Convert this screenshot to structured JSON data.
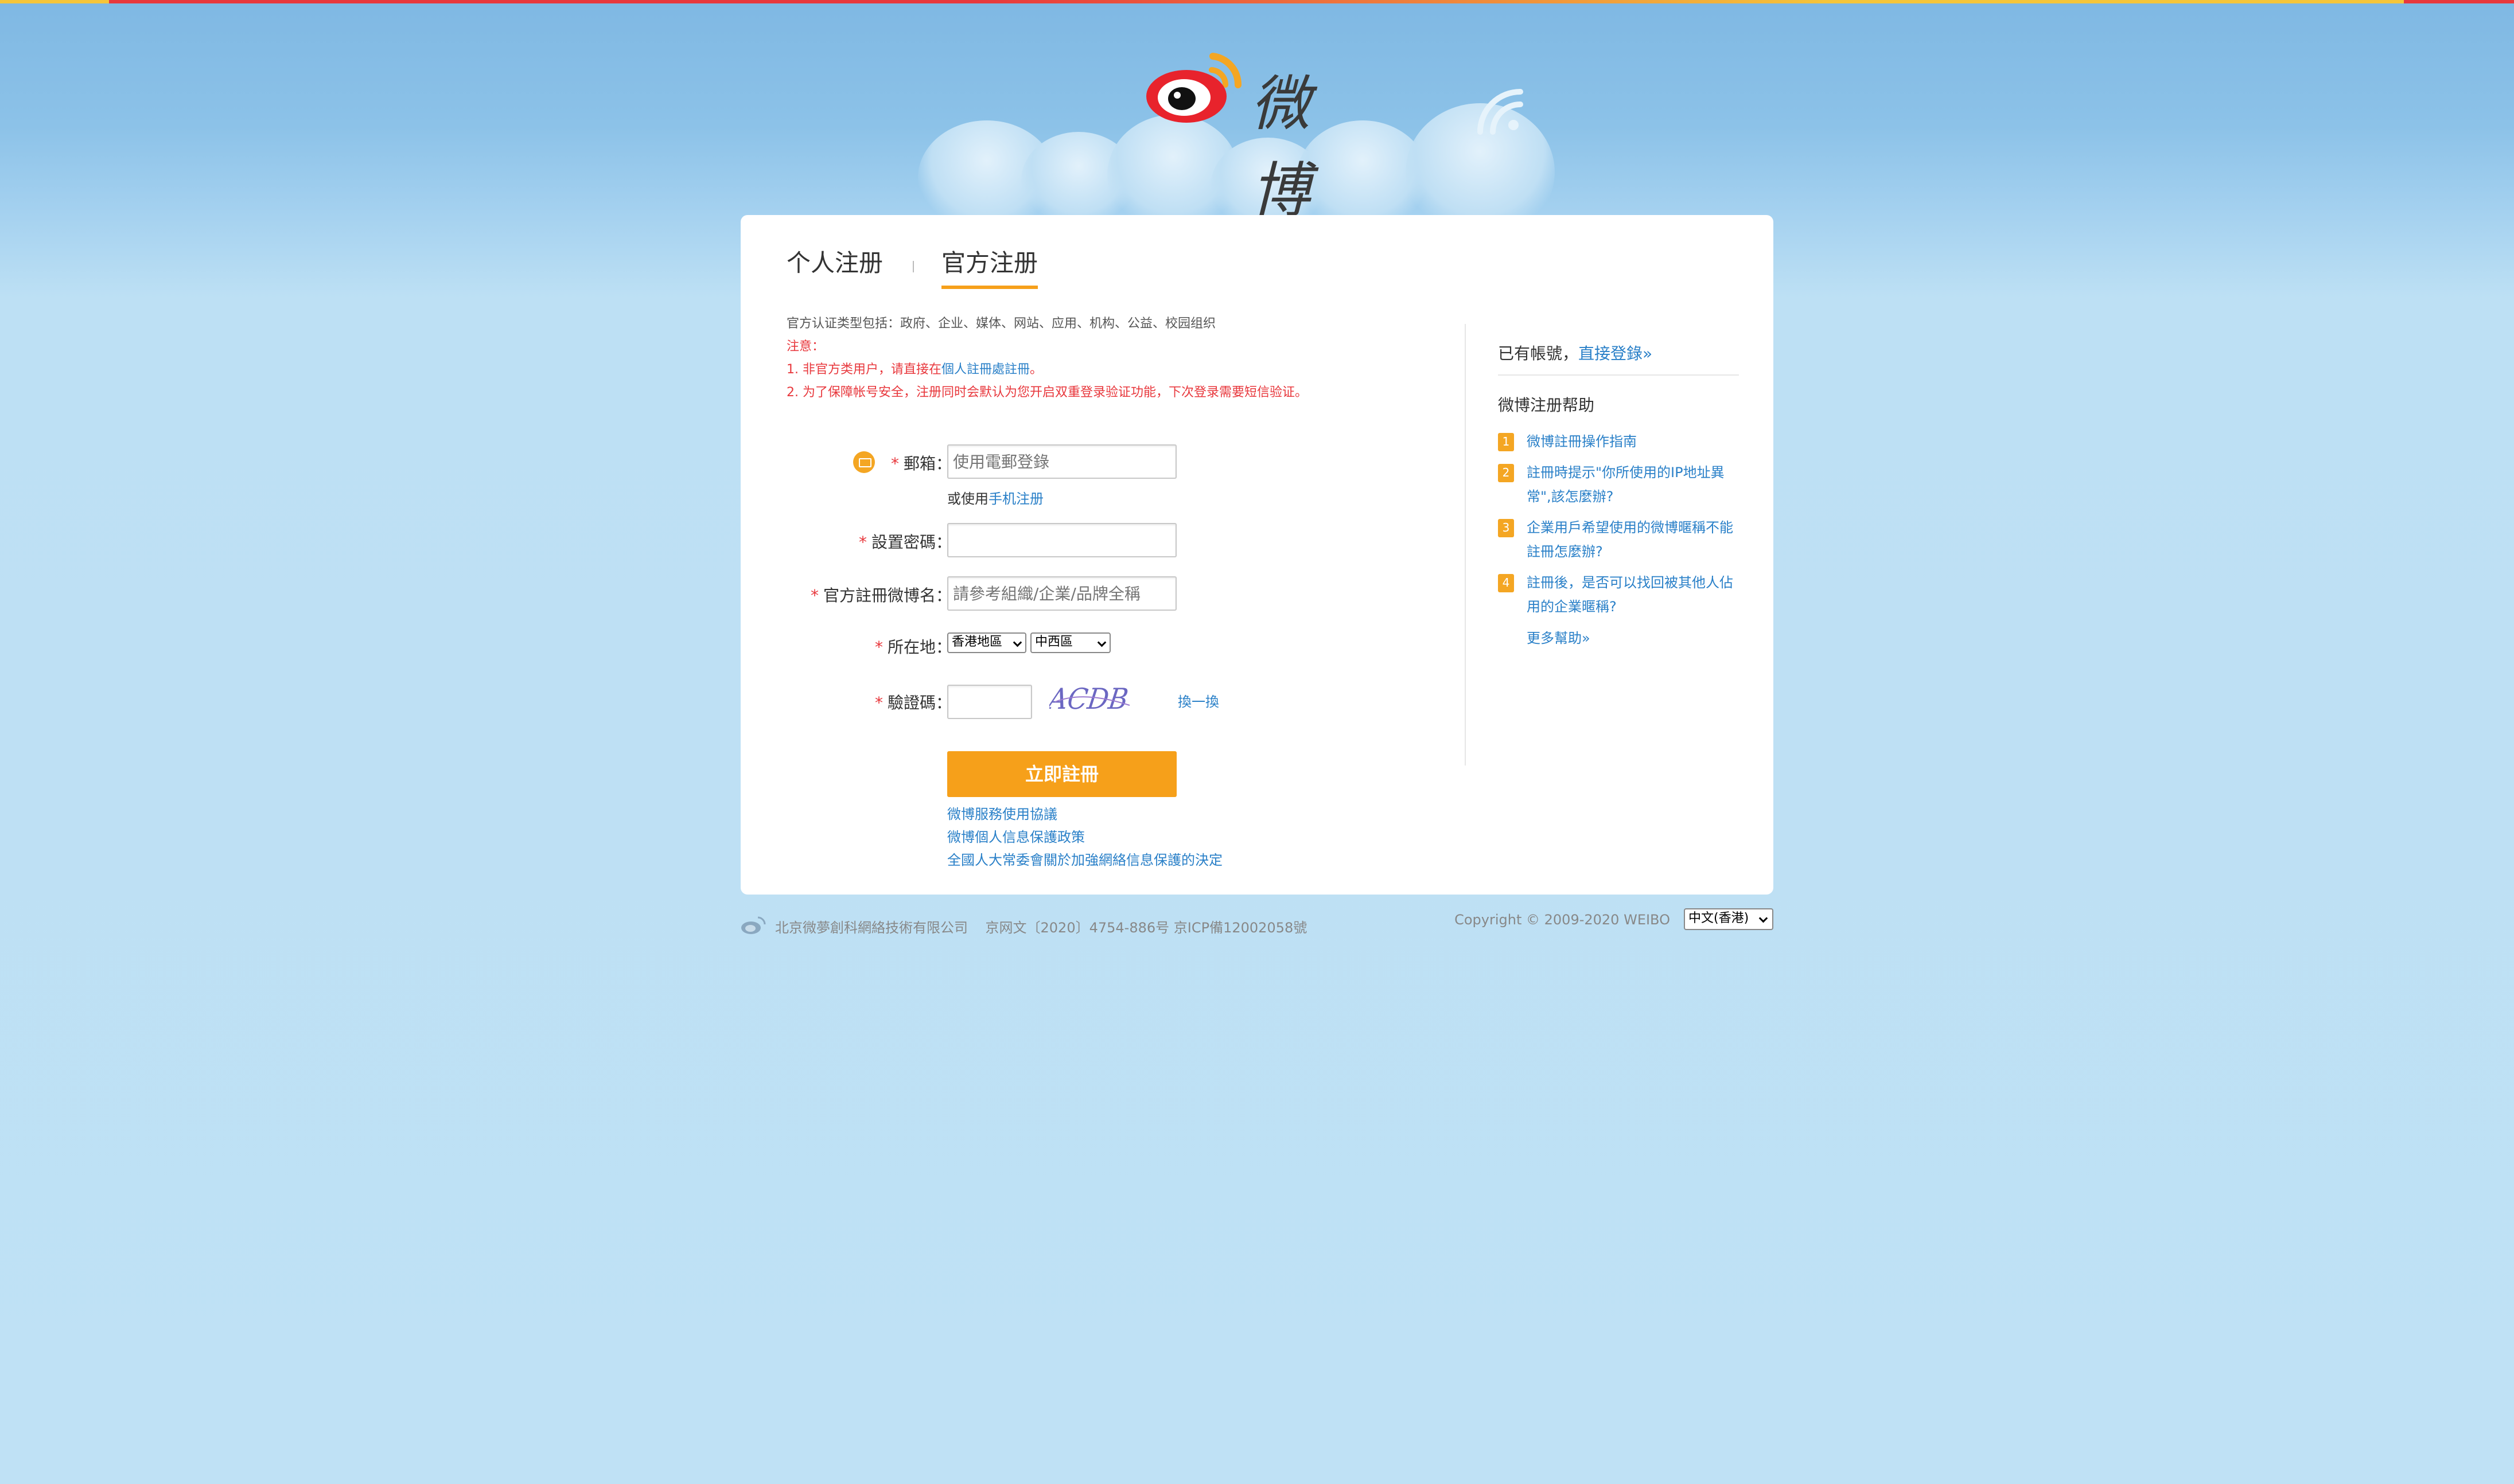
{
  "brand": {
    "logo_text": "微博"
  },
  "tabs": {
    "personal": "个人注册",
    "official": "官方注册"
  },
  "notes": {
    "types": "官方认证类型包括：政府、企业、媒体、网站、应用、机构、公益、校园组织",
    "notice_title": "注意：",
    "note1_prefix": "1. 非官方类用户，请直接在",
    "note1_link": "個人註冊處註冊",
    "note1_suffix": "。",
    "note2": "2. 为了保障帐号安全，注册同时会默认为您开启双重登录验证功能，下次登录需要短信验证。"
  },
  "form": {
    "required_mark": "*",
    "email_label": "郵箱：",
    "email_placeholder": "使用電郵登錄",
    "alt_prefix": "或使用",
    "alt_link": "手机注册",
    "password_label": "設置密碼：",
    "name_label": "官方註冊微博名：",
    "name_placeholder": "請參考組織/企業/品牌全稱",
    "location_label": "所在地：",
    "region_value": "香港地區",
    "district_value": "中西區",
    "captcha_label": "驗證碼：",
    "captcha_text": "ACDB",
    "refresh_label": "換一換",
    "submit_label": "立即註冊"
  },
  "policies": [
    "微博服務使用協議",
    "微博個人信息保護政策",
    "全國人大常委會關於加強網絡信息保護的決定"
  ],
  "sidebar": {
    "has_account": "已有帳號，",
    "login_link": "直接登錄»",
    "help_title": "微博注册帮助",
    "help_items": [
      {
        "num": "1",
        "text": "微博註冊操作指南"
      },
      {
        "num": "2",
        "text": "註冊時提示\"你所使用的IP地址異常\",該怎麼辦?"
      },
      {
        "num": "3",
        "text": "企業用戶希望使用的微博暱稱不能註冊怎麼辦?"
      },
      {
        "num": "4",
        "text": "註冊後，是否可以找回被其他人佔用的企業暱稱?"
      }
    ],
    "more_help": "更多幫助»"
  },
  "footer": {
    "company": "北京微夢創科網絡技術有限公司",
    "license": "京网文〔2020〕4754-886号 京ICP備12002058號",
    "copyright": "Copyright © 2009-2020 WEIBO",
    "language": "中文(香港)"
  },
  "colors": {
    "accent": "#f6a01a",
    "link": "#2a80c8",
    "warning": "#e8383d",
    "background": "#bfe1f5"
  }
}
